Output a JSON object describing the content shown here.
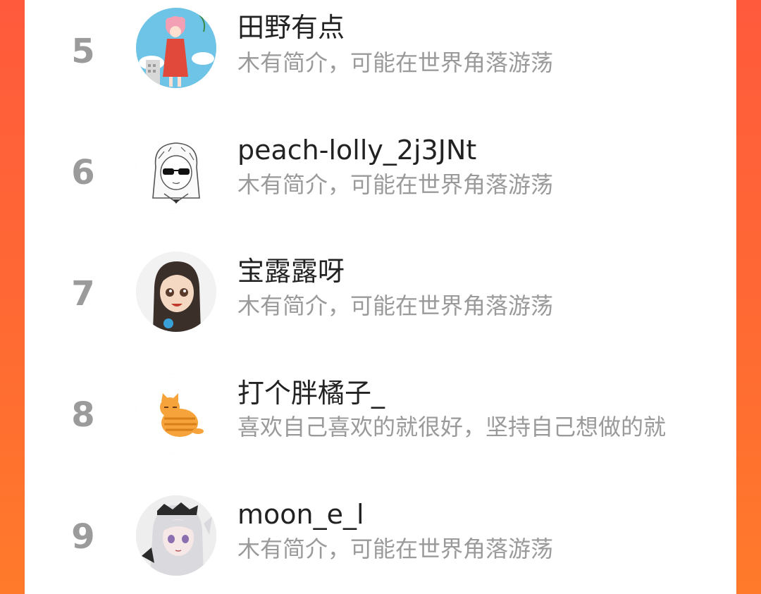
{
  "ranking": {
    "items": [
      {
        "rank": "5",
        "name": "田野有点",
        "bio": "木有简介，可能在世界角落游荡",
        "avatar_icon": "girl-red-dress-avatar"
      },
      {
        "rank": "6",
        "name": "peach-lolly_2j3JNt",
        "bio": "木有简介，可能在世界角落游荡",
        "avatar_icon": "sunglasses-girl-sketch-avatar"
      },
      {
        "rank": "7",
        "name": "宝露露呀",
        "bio": "木有简介，可能在世界角落游荡",
        "avatar_icon": "long-hair-girl-avatar"
      },
      {
        "rank": "8",
        "name": "打个胖橘子_",
        "bio": "喜欢自己喜欢的就很好，坚持自己想做的就",
        "avatar_icon": "orange-cat-avatar"
      },
      {
        "rank": "9",
        "name": "moon_e_l",
        "bio": "木有简介，可能在世界角落游荡",
        "avatar_icon": "white-hair-anime-avatar"
      }
    ]
  },
  "colors": {
    "accent_left": "#ff5a3c",
    "accent_right": "#ff7a2a",
    "rank_gray": "#9b9b9b",
    "name_text": "#222222",
    "bio_text": "#9a9a9a"
  }
}
